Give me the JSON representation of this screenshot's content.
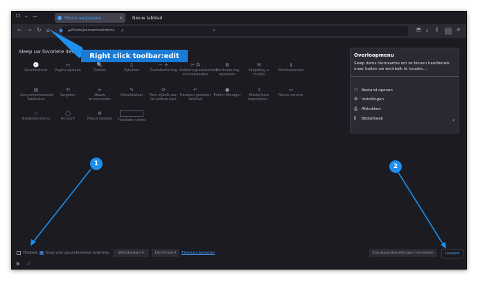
{
  "tabs": {
    "active_label": "Floorp aanpassen",
    "new_tab_label": "Nieuw tabblad"
  },
  "urlbar": {
    "bookmarks_label": "Bladwijzerwerkbalkitems"
  },
  "customize": {
    "heading": "Sleep uw favoriete items naar de werkbalk",
    "items": [
      {
        "icon": "history-icon",
        "glyph": "🕘",
        "label": "Geschiedenis"
      },
      {
        "icon": "print-page-icon",
        "glyph": "▭",
        "label": "Pagina opslaan"
      },
      {
        "icon": "search-icon",
        "glyph": "🔍",
        "label": "Zoeken"
      },
      {
        "icon": "sidebar-icon",
        "glyph": "▯",
        "label": "Zijbalken"
      },
      {
        "icon": "zoom-icon",
        "glyph": "− +",
        "label": "Zoombediening"
      },
      {
        "icon": "edit-controls-icon",
        "glyph": "✂ ⧉",
        "label": "Bedieningselementen voor bewerken"
      },
      {
        "icon": "text-encoding-icon",
        "glyph": "≣",
        "label": "Tekstcodering repareren"
      },
      {
        "icon": "email-link-icon",
        "glyph": "✉",
        "label": "Koppeling e-mailen"
      },
      {
        "icon": "passwords-icon",
        "glyph": "⚷",
        "label": "Wachtwoorden"
      },
      {
        "icon": "closed-tabs-icon",
        "glyph": "▤",
        "label": "Gesynchroniseerde tabbladen"
      },
      {
        "icon": "forget-icon",
        "glyph": "⟲",
        "label": "Vergeten"
      },
      {
        "icon": "private-window-icon",
        "glyph": "∞",
        "label": "Nieuw privévenster"
      },
      {
        "icon": "developer-icon",
        "glyph": "✎",
        "label": "Ontwikkelaar"
      },
      {
        "icon": "toggle-sidebar-icon",
        "glyph": "⟳",
        "label": "Toon zijbalk aan de andere kant"
      },
      {
        "icon": "undo-close-icon",
        "glyph": "↶",
        "label": "Heropen gesloten tabblad"
      },
      {
        "icon": "profile-manager-icon",
        "glyph": "●",
        "label": "Profiel Manager"
      },
      {
        "icon": "import-bookmarks-icon",
        "glyph": "⇩",
        "label": "Bladwijzers importeren..."
      },
      {
        "icon": "new-window-icon",
        "glyph": "▭",
        "label": "Nieuw venster"
      },
      {
        "icon": "bookmarks-menu-icon",
        "glyph": "☆",
        "label": "Bladwijzermenu"
      },
      {
        "icon": "account-icon",
        "glyph": "◯",
        "label": "Account"
      },
      {
        "icon": "new-tab-icon",
        "glyph": "⊕",
        "label": "Nieuw tabblad"
      },
      {
        "icon": "flexible-space-icon",
        "glyph": "",
        "label": "Flexibele ruimte"
      }
    ]
  },
  "overflow_menu": {
    "title": "Overloopmenu",
    "description": "Sleep items hiernaartoe om ze binnen handbereik maar buiten uw werkbalk te houden…",
    "items": [
      {
        "icon": "folder-icon",
        "glyph": "🗀",
        "label": "Bestand openen"
      },
      {
        "icon": "gear-icon",
        "glyph": "⚙",
        "label": "Instellingen"
      },
      {
        "icon": "printer-icon",
        "glyph": "⎙",
        "label": "Afdrukken"
      },
      {
        "icon": "library-icon",
        "glyph": "⫼",
        "label": "Bibliotheek"
      }
    ]
  },
  "footer": {
    "titlebar_label": "Titelbalk",
    "compact_label": "Knop voor gecombineerde extensies",
    "toolbars_label": "Werkbalken ▾",
    "density_label": "Dichtheid ▾",
    "themes_label": "Thema's beheren",
    "restore_label": "Standaardinstellingen herstellen",
    "done_label": "Gereed"
  },
  "annotation": {
    "tooltip": "Right click toolbar:edit",
    "badge1": "1",
    "badge2": "2"
  },
  "colors": {
    "accent": "#1d90ef",
    "background": "#1c1b22",
    "link": "#45a1ff"
  }
}
